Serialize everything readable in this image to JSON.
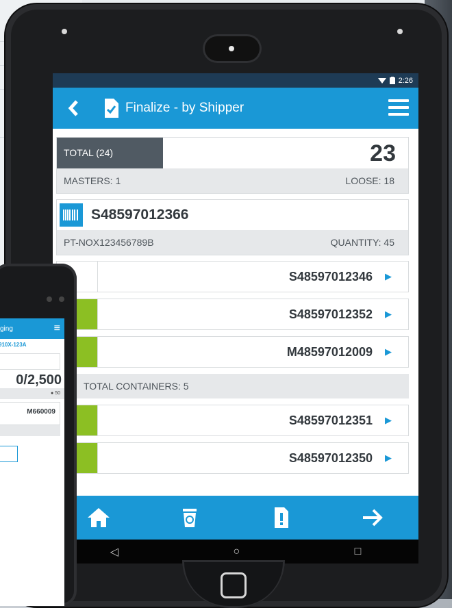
{
  "status_bar": {
    "time": "2:26"
  },
  "header": {
    "title": "Finalize - by Shipper",
    "back_icon": "chevron-left-icon",
    "menu_icon": "hamburger-menu-icon"
  },
  "summary": {
    "total_label": "TOTAL (24)",
    "total_value": "23",
    "masters": "MASTERS: 1",
    "loose": "LOOSE: 18"
  },
  "shipment": {
    "barcode": "S48597012366",
    "part": "PT-NOX123456789B",
    "quantity": "QUANTITY: 45"
  },
  "items_top": [
    {
      "code": "S48597012346",
      "style": "plain"
    },
    {
      "code": "S48597012352",
      "style": "green"
    },
    {
      "code": "M48597012009",
      "style": "green"
    }
  ],
  "total_containers": "TOTAL CONTAINERS: 5",
  "items_bottom": [
    {
      "code": "S48597012351",
      "style": "green"
    },
    {
      "code": "S48597012350",
      "style": "green"
    }
  ],
  "bottom_nav": [
    "home-icon",
    "recycle-bin-icon",
    "alert-document-icon",
    "arrow-right-icon"
  ],
  "android_nav": {
    "back": "◁",
    "home": "○",
    "recent": "□"
  },
  "phone": {
    "title": "ging",
    "sub": "910X-123A",
    "big": "0/2,500",
    "small": "50",
    "code": "M660009"
  },
  "colors": {
    "primary": "#1a98d6",
    "green": "#8cbf23",
    "dark_tag": "#505a63"
  }
}
